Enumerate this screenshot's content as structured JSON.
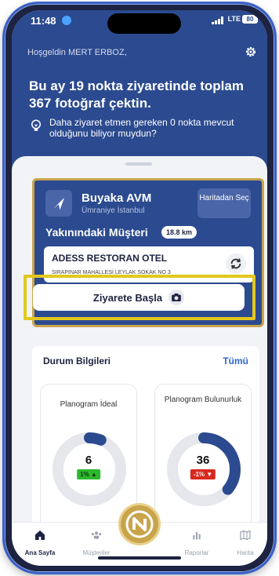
{
  "status_bar": {
    "time": "11:48",
    "network": "LTE",
    "battery": "80"
  },
  "header": {
    "greeting": "Hoşgeldin MERT ERBOZ,",
    "summary": "Bu ay 19 nokta ziyaretinde toplam 367 fotoğraf çektin.",
    "info": "Daha ziyaret etmen gereken 0 nokta mevcut olduğunu biliyor muydun?"
  },
  "visit": {
    "place_name": "Buyaka AVM",
    "place_location": "Ümraniye İstanbul",
    "map_button": "Haritadan Seç",
    "nearby_title": "Yakınındaki Müşteri",
    "distance": "18.8 km",
    "customer_name": "ADESS RESTORAN OTEL",
    "customer_address": "SIRAPINAR MAHALLESİ LEYLAK SOKAK NO 3",
    "start_button": "Ziyarete Başla"
  },
  "status": {
    "title": "Durum Bilgileri",
    "all_link": "Tümü",
    "metrics": [
      {
        "label": "Planogram İdeal",
        "value": "6",
        "change": "1% ▲",
        "progress": 0.06
      },
      {
        "label": "Planogram Bulunurluk",
        "value": "36",
        "change": "-1% ▼",
        "progress": 0.36
      }
    ]
  },
  "tabs": [
    {
      "label": "Ana Sayfa",
      "icon": "home-icon"
    },
    {
      "label": "Müşteriler",
      "icon": "users-icon"
    },
    {
      "label": "Raporlar",
      "icon": "bar-chart-icon"
    },
    {
      "label": "Harita",
      "icon": "map-icon"
    }
  ],
  "colors": {
    "primary": "#2b4a8f",
    "accent": "#c9a44b",
    "highlight": "#e2c81d",
    "link": "#2b67c9"
  }
}
